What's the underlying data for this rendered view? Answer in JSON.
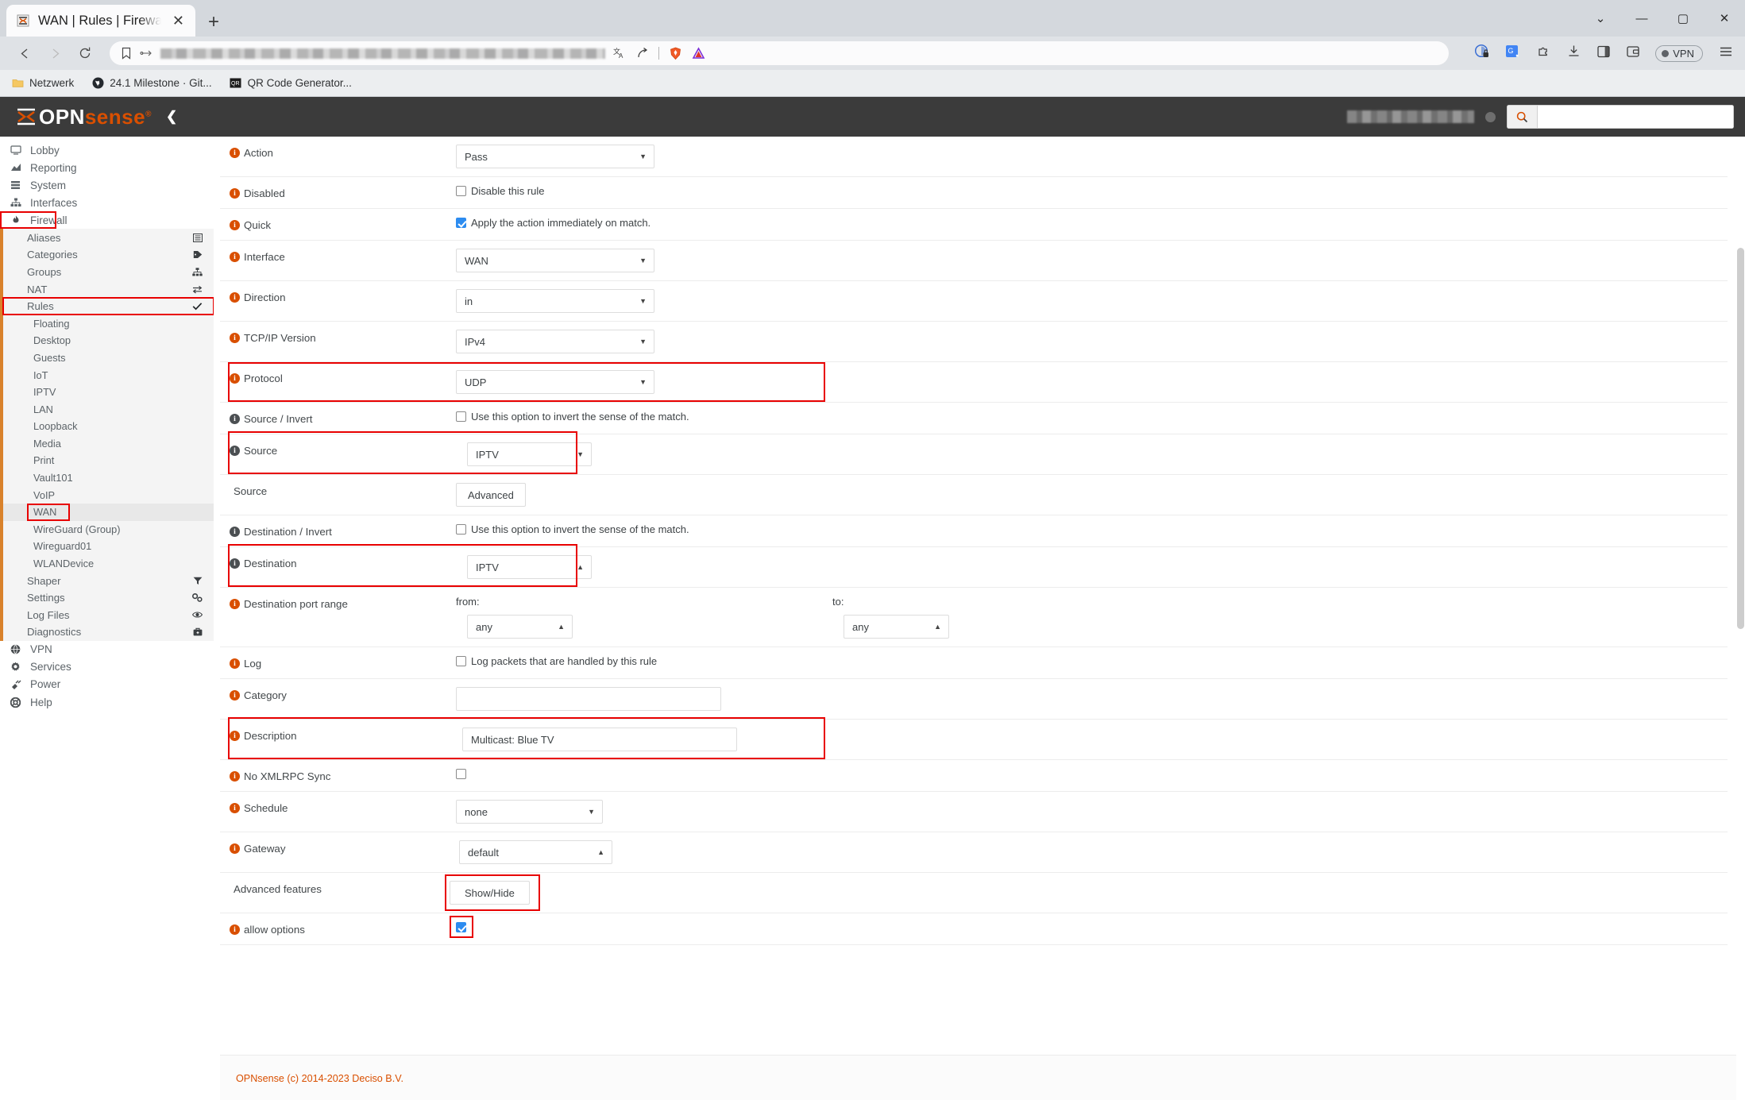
{
  "browser": {
    "tab": {
      "title": "WAN | Rules | Firewall | OPNsens",
      "favicon": "opnsense-favicon",
      "close": "✕"
    },
    "newtab_label": "+",
    "window_controls": {
      "minimize": "—",
      "maximize": "▢",
      "close": "✕",
      "chevron": "⌄"
    },
    "nav": {
      "back": "◁",
      "forward": "▷",
      "reload": "⟳"
    },
    "url_value": "",
    "url_redacted": true,
    "bookmarks": [
      {
        "label": "Netzwerk",
        "icon": "folder-icon"
      },
      {
        "label": "24.1 Milestone · Git...",
        "icon": "github-icon"
      },
      {
        "label": "QR Code Generator...",
        "icon": "qr-icon"
      }
    ],
    "toolbar_right": {
      "vpn_label": "VPN",
      "icons": [
        "translate-icon",
        "share-icon",
        "brave-shield-icon",
        "brave-triangle-icon",
        "privacy-icon",
        "translate-google-icon",
        "extensions-icon",
        "downloads-icon",
        "sidebar-icon",
        "wallet-icon",
        "menu-icon"
      ]
    }
  },
  "app": {
    "brand": {
      "name": "OPN",
      "accent": "sense",
      "registered": "®"
    },
    "collapse_icon": "chevron-left-icon",
    "user_redacted": true,
    "search_placeholder": ""
  },
  "sidebar": {
    "top": [
      {
        "label": "Lobby",
        "icon": "monitor-icon"
      },
      {
        "label": "Reporting",
        "icon": "chart-icon"
      },
      {
        "label": "System",
        "icon": "server-icon"
      },
      {
        "label": "Interfaces",
        "icon": "network-icon"
      }
    ],
    "firewall": {
      "label": "Firewall",
      "icon": "flame-icon",
      "highlighted": true
    },
    "firewall_children": [
      {
        "label": "Aliases",
        "icon": "list-icon"
      },
      {
        "label": "Categories",
        "icon": "tag-icon"
      },
      {
        "label": "Groups",
        "icon": "sitemap-icon"
      },
      {
        "label": "NAT",
        "icon": "exchange-icon"
      },
      {
        "label": "Rules",
        "icon": "check-icon",
        "highlighted": true
      }
    ],
    "rules_children": [
      {
        "label": "Floating"
      },
      {
        "label": "Desktop"
      },
      {
        "label": "Guests"
      },
      {
        "label": "IoT"
      },
      {
        "label": "IPTV"
      },
      {
        "label": "LAN"
      },
      {
        "label": "Loopback"
      },
      {
        "label": "Media"
      },
      {
        "label": "Print"
      },
      {
        "label": "Vault101"
      },
      {
        "label": "VoIP"
      },
      {
        "label": "WAN",
        "active": true,
        "highlighted": true
      },
      {
        "label": "WireGuard (Group)"
      },
      {
        "label": "Wireguard01"
      },
      {
        "label": "WLANDevice"
      }
    ],
    "firewall_children_tail": [
      {
        "label": "Shaper",
        "icon": "filter-icon"
      },
      {
        "label": "Settings",
        "icon": "sliders-icon"
      },
      {
        "label": "Log Files",
        "icon": "eye-icon"
      },
      {
        "label": "Diagnostics",
        "icon": "briefcase-icon"
      }
    ],
    "bottom": [
      {
        "label": "VPN",
        "icon": "globe-icon"
      },
      {
        "label": "Services",
        "icon": "gear-icon"
      },
      {
        "label": "Power",
        "icon": "plug-icon"
      },
      {
        "label": "Help",
        "icon": "lifebuoy-icon"
      }
    ]
  },
  "form": {
    "action": {
      "label": "Action",
      "value": "Pass"
    },
    "disabled": {
      "label": "Disabled",
      "checkbox_label": "Disable this rule",
      "checked": false
    },
    "quick": {
      "label": "Quick",
      "checkbox_label": "Apply the action immediately on match.",
      "checked": true
    },
    "interface": {
      "label": "Interface",
      "value": "WAN"
    },
    "direction": {
      "label": "Direction",
      "value": "in"
    },
    "tcpip": {
      "label": "TCP/IP Version",
      "value": "IPv4"
    },
    "protocol": {
      "label": "Protocol",
      "value": "UDP",
      "highlighted": true
    },
    "source_invert": {
      "label": "Source / Invert",
      "checkbox_label": "Use this option to invert the sense of the match.",
      "checked": false
    },
    "source": {
      "label": "Source",
      "value": "IPTV",
      "highlighted": true,
      "chevron": "down"
    },
    "source_adv": {
      "label": "Source",
      "button": "Advanced"
    },
    "dest_invert": {
      "label": "Destination / Invert",
      "checkbox_label": "Use this option to invert the sense of the match.",
      "checked": false
    },
    "destination": {
      "label": "Destination",
      "value": "IPTV",
      "highlighted": true,
      "chevron": "up"
    },
    "dest_port": {
      "label": "Destination port range",
      "from_label": "from:",
      "from_value": "any",
      "to_label": "to:",
      "to_value": "any"
    },
    "log": {
      "label": "Log",
      "checkbox_label": "Log packets that are handled by this rule",
      "checked": false
    },
    "category": {
      "label": "Category",
      "value": ""
    },
    "description": {
      "label": "Description",
      "value": "Multicast: Blue TV",
      "highlighted": true
    },
    "no_xmlrpc": {
      "label": "No XMLRPC Sync",
      "checked": false
    },
    "schedule": {
      "label": "Schedule",
      "value": "none",
      "chevron": "down"
    },
    "gateway": {
      "label": "Gateway",
      "value": "default",
      "chevron": "up"
    },
    "advanced": {
      "label": "Advanced features",
      "button": "Show/Hide",
      "highlighted": true
    },
    "allow_options": {
      "label": "allow options",
      "checked": true,
      "highlighted": true
    }
  },
  "footer": {
    "text": "OPNsense (c) 2014-2023 Deciso B.V."
  },
  "colors": {
    "accent": "#d94f00",
    "highlight": "#e80000",
    "checkbox": "#2d8cf0",
    "topbar": "#3b3b3b"
  }
}
